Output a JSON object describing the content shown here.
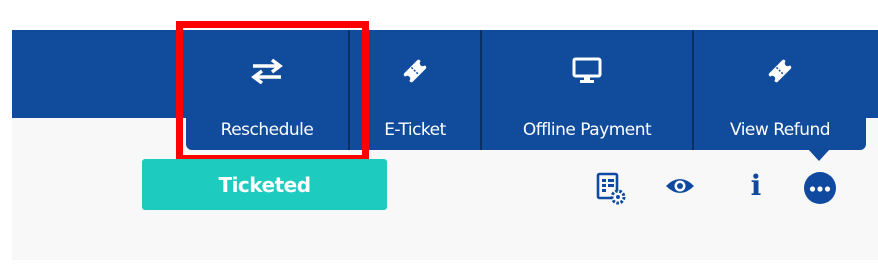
{
  "action_menu": {
    "items": [
      {
        "label": "Reschedule",
        "icon": "swap-arrows-icon"
      },
      {
        "label": "E-Ticket",
        "icon": "ticket-icon"
      },
      {
        "label": "Offline Payment",
        "icon": "monitor-icon"
      },
      {
        "label": "View Refund",
        "icon": "ticket-icon"
      }
    ],
    "highlighted_item": "Reschedule"
  },
  "booking_row": {
    "status": "Ticketed",
    "actions": [
      {
        "icon": "invoice-settings-icon"
      },
      {
        "icon": "eye-icon"
      },
      {
        "icon": "info-icon"
      },
      {
        "icon": "more-options-icon"
      }
    ]
  },
  "colors": {
    "menu_background": "#114b9b",
    "menu_divider": "#0a2f63",
    "status_badge": "#1ecbbf",
    "highlight": "#ff0000",
    "action_icon": "#0f4aa0"
  }
}
